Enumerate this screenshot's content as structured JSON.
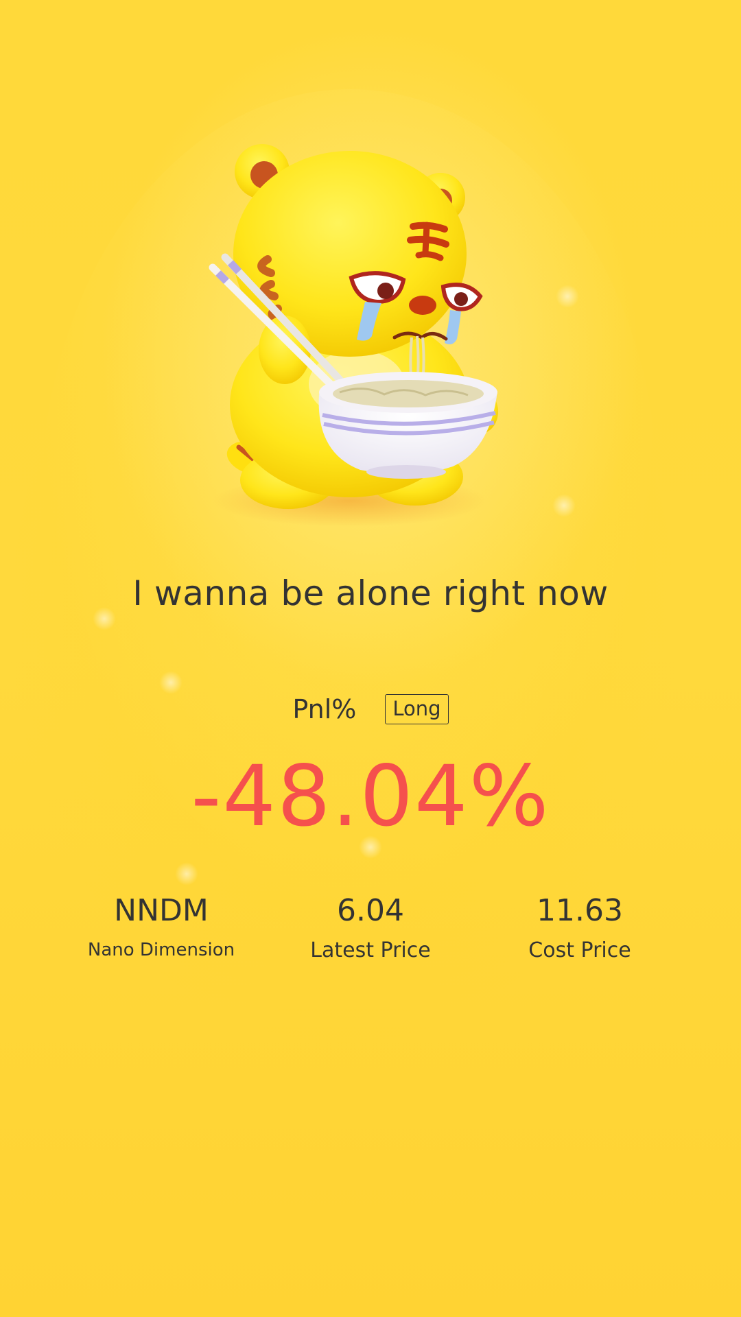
{
  "headline": "I wanna be alone right now",
  "pnl": {
    "label": "Pnl%",
    "direction": "Long",
    "value": "-48.04%"
  },
  "stock": {
    "symbol": "NNDM",
    "name": "Nano Dimension",
    "latest_price": "6.04",
    "latest_price_label": "Latest Price",
    "cost_price": "11.63",
    "cost_price_label": "Cost Price"
  },
  "colors": {
    "background": "#ffd93a",
    "loss_red": "#f5504d",
    "text_dark": "#333333"
  },
  "icons": {
    "mascot": "crying-tiger-eating-noodles-illustration"
  }
}
